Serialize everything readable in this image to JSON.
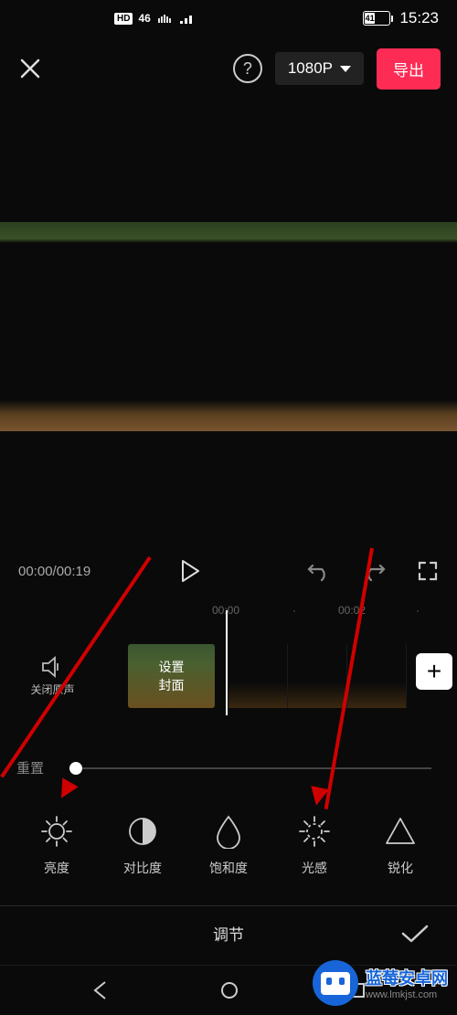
{
  "status": {
    "hd": "HD",
    "net": "46",
    "battery": "41",
    "time": "15:23"
  },
  "top": {
    "resolution": "1080P",
    "export": "导出"
  },
  "controls": {
    "time": "00:00/00:19"
  },
  "ruler": {
    "t1": "00:00",
    "t2": "00:02"
  },
  "timeline": {
    "mute": "关闭原声",
    "cover_l1": "设置",
    "cover_l2": "封面"
  },
  "reset": "重置",
  "tools": [
    {
      "label": "亮度"
    },
    {
      "label": "对比度"
    },
    {
      "label": "饱和度"
    },
    {
      "label": "光感"
    },
    {
      "label": "锐化"
    }
  ],
  "bottom": {
    "title": "调节"
  },
  "watermark": {
    "main": "蓝莓安卓网",
    "sub": "www.lmkjst.com"
  }
}
